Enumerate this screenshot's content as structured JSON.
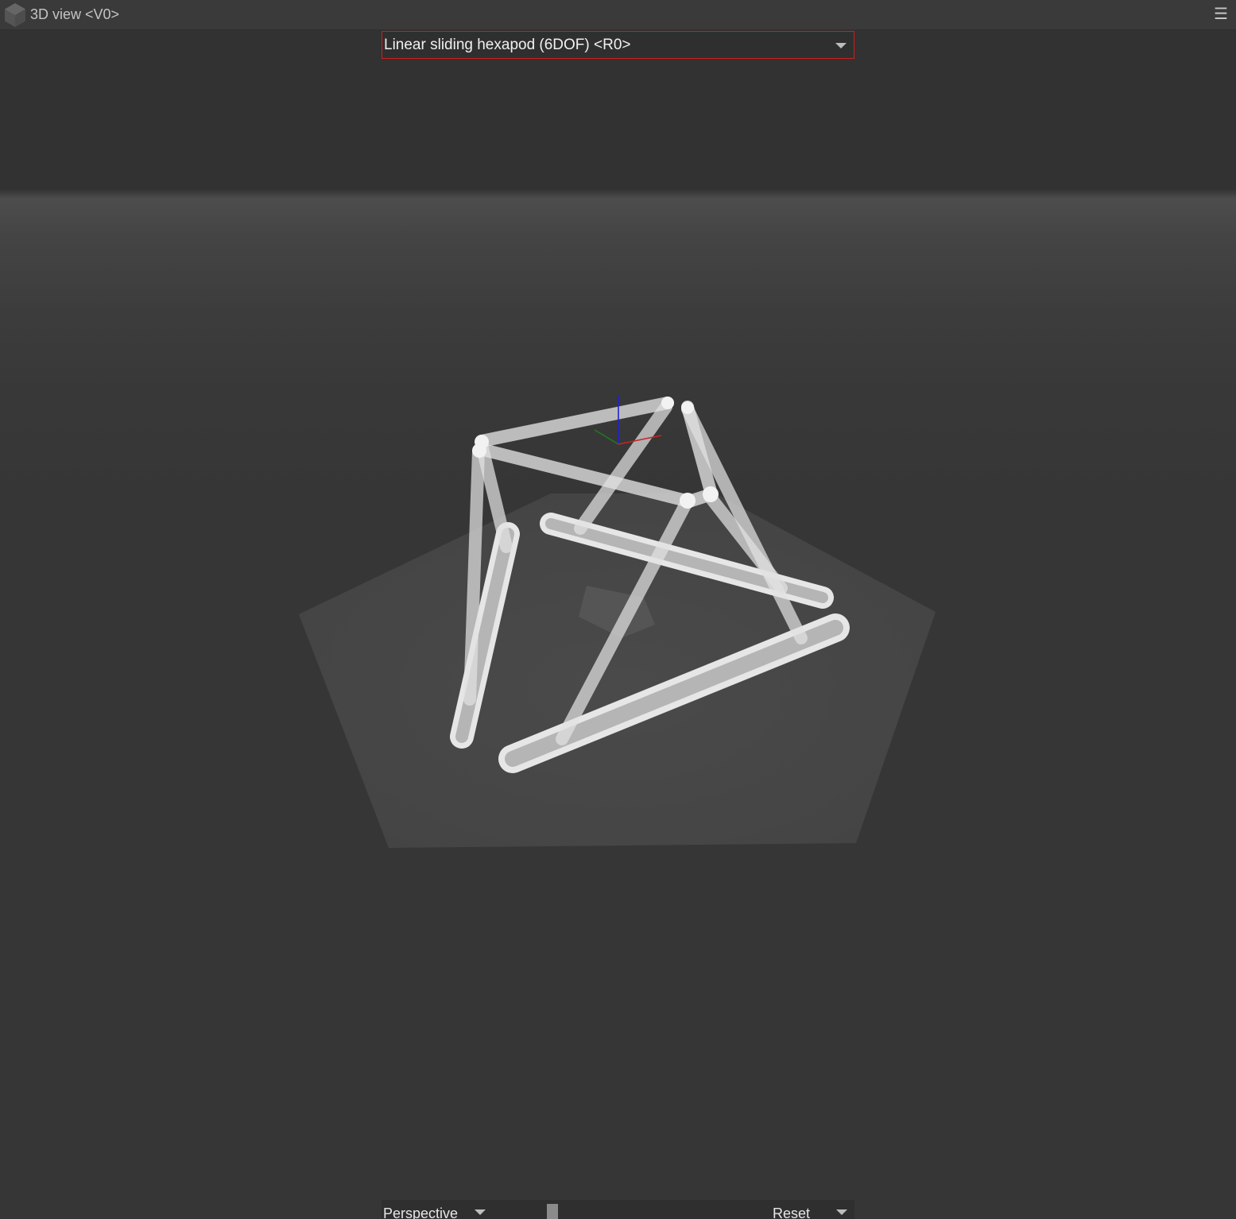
{
  "window": {
    "title": "3D view <V0>",
    "logo_icon": "cube-logo-icon",
    "menu_icon": "hamburger-menu-icon",
    "menu_glyph": "☰"
  },
  "robot_selector": {
    "selected": "Linear sliding hexapod (6DOF) <R0>",
    "icon": "chevron-down-icon"
  },
  "bottom_bar": {
    "projection_mode": "Perspective",
    "projection_icon": "chevron-down-icon",
    "zoom_handle_icon": "slider-handle",
    "reset_label": "Reset",
    "reset_icon": "chevron-down-icon"
  },
  "scene": {
    "model": "hexapod",
    "axes_colors": {
      "x": "#cc2222",
      "y": "#227722",
      "z": "#2222cc"
    },
    "platform_color": "#4a4a4a",
    "strut_color": "#e2e2e2",
    "rail_color": "#b0b0b0"
  }
}
